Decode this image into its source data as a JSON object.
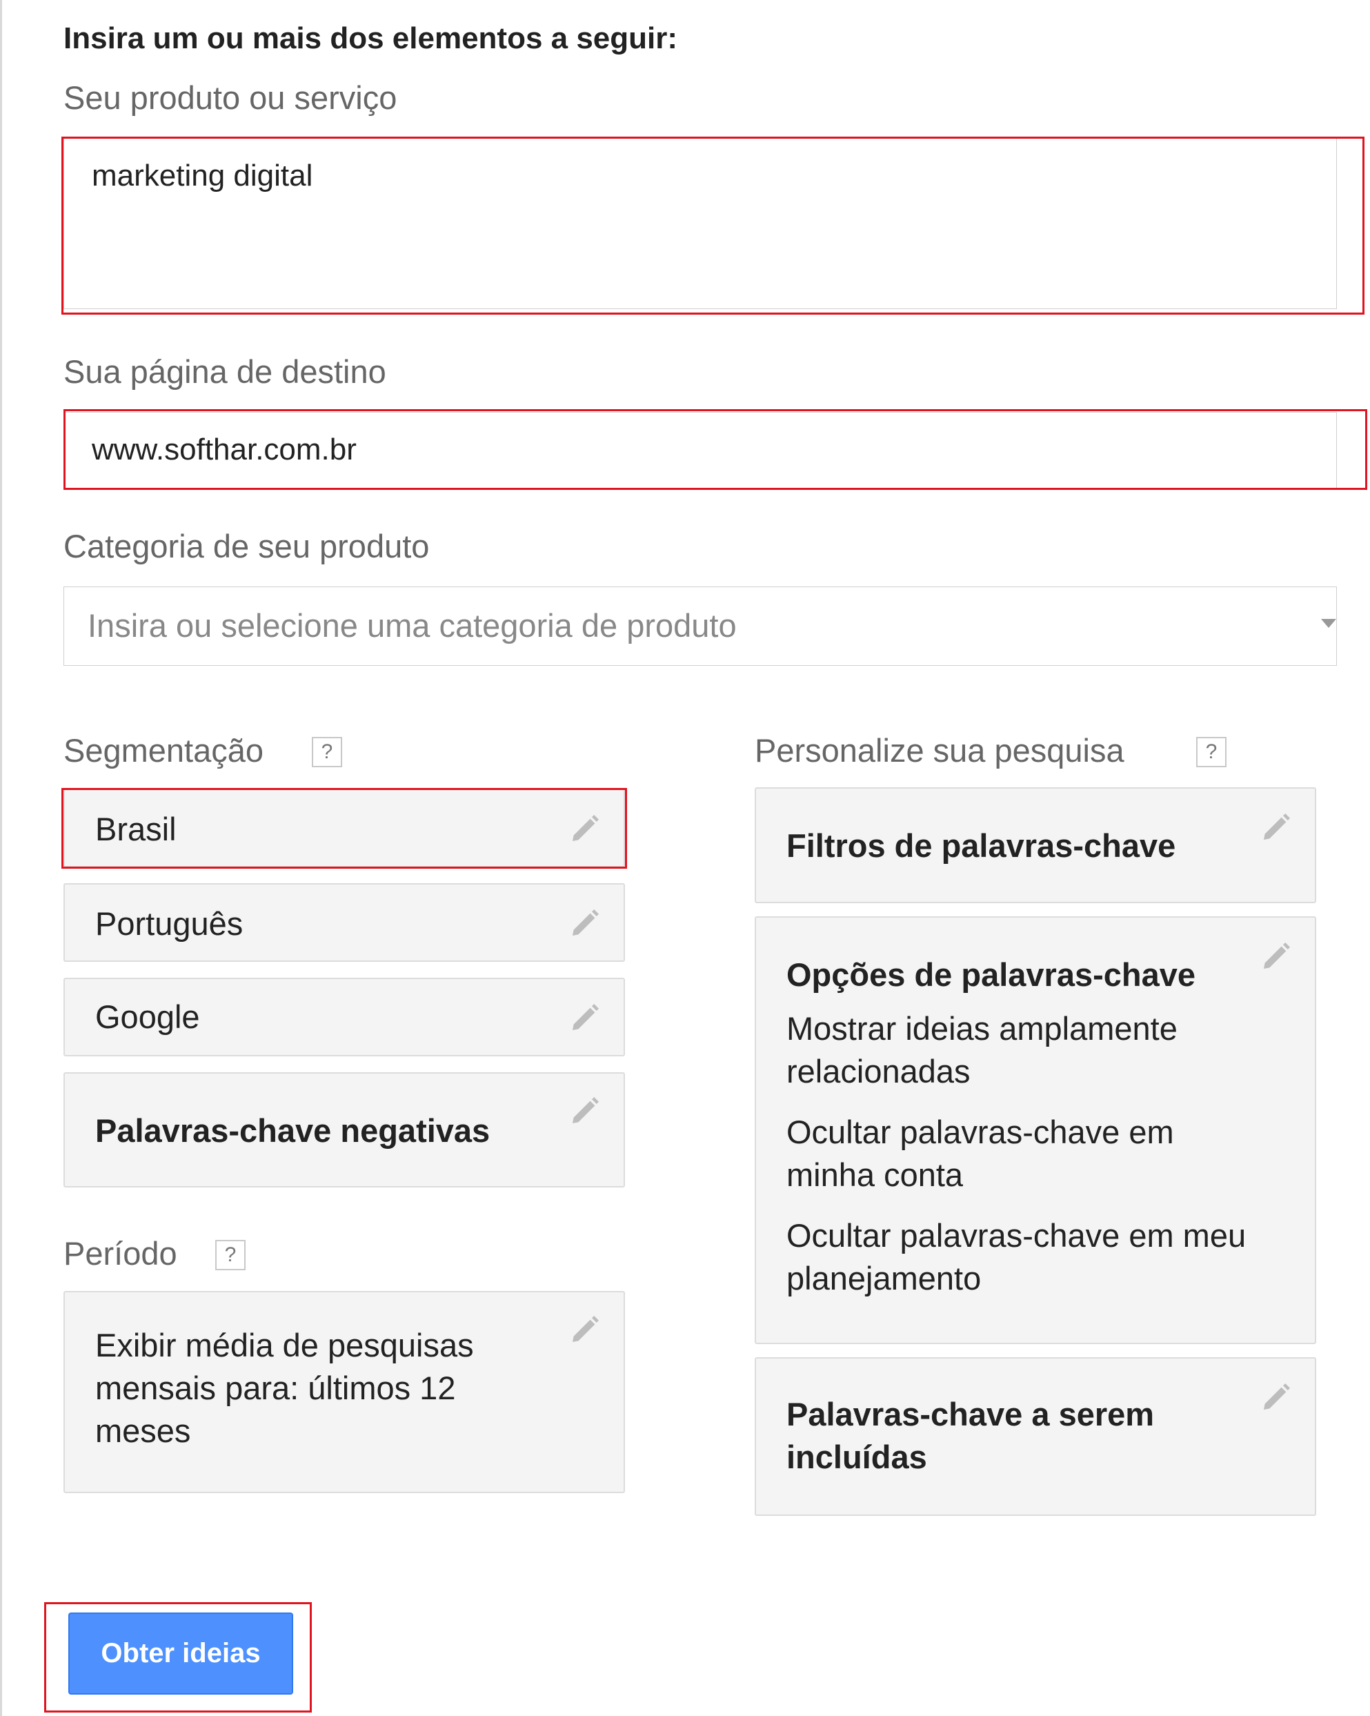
{
  "header": {
    "title": "Insira um ou mais dos elementos a seguir:"
  },
  "product_field": {
    "label": "Seu produto ou serviço",
    "value": "marketing digital"
  },
  "landing_page_field": {
    "label": "Sua página de destino",
    "value": "www.softhar.com.br"
  },
  "category_field": {
    "label": "Categoria de seu produto",
    "placeholder": "Insira ou selecione uma categoria de produto"
  },
  "targeting": {
    "label": "Segmentação",
    "help": "?",
    "items": [
      {
        "label": "Brasil"
      },
      {
        "label": "Português"
      },
      {
        "label": "Google"
      },
      {
        "label": "Palavras-chave negativas"
      }
    ]
  },
  "period": {
    "label": "Período",
    "help": "?",
    "lines": [
      "Exibir média de pesquisas",
      "mensais para: últimos 12",
      "meses"
    ]
  },
  "customize": {
    "label": "Personalize sua pesquisa",
    "help": "?",
    "filters_title": "Filtros de palavras-chave",
    "options_title": "Opções de palavras-chave",
    "options_lines": [
      "Mostrar ideias amplamente",
      "relacionadas",
      "Ocultar palavras-chave em",
      "minha conta",
      "Ocultar palavras-chave em meu",
      "planejamento"
    ],
    "include_title_lines": [
      "Palavras-chave a serem",
      "incluídas"
    ]
  },
  "actions": {
    "get_ideas": "Obter ideias"
  },
  "colors": {
    "accent_button": "#4d90fe",
    "highlight": "#e0141e"
  },
  "icons": {
    "edit": "pencil-icon",
    "help": "help-icon",
    "dropdown": "chevron-down-icon"
  }
}
